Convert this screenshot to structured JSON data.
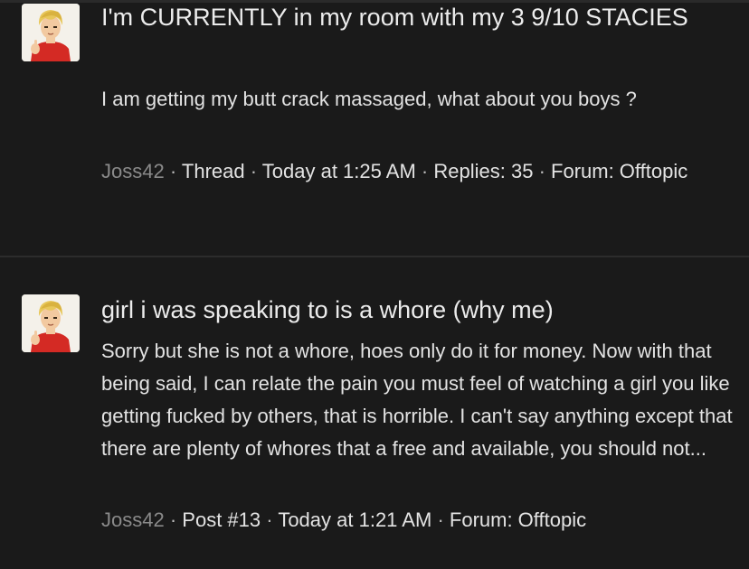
{
  "results": [
    {
      "title": "I'm CURRENTLY in my room with my 3 9/10 STACIES",
      "snippet": "I am getting my butt crack massaged, what about you boys ?",
      "meta": {
        "author": "Joss42",
        "type": "Thread",
        "date": "Today at 1:25 AM",
        "replies": "Replies: 35",
        "forum": "Forum: Offtopic"
      }
    },
    {
      "title": "girl i was speaking to is a whore (why me)",
      "snippet": "Sorry but she is not a whore, hoes only do it for money. Now with that being said, I can relate the pain you must feel of watching a girl you like getting fucked by others, that is horrible. I can't say anything except that there are plenty of whores that a free and available, you should not...",
      "meta": {
        "author": "Joss42",
        "type": "Post #13",
        "date": "Today at 1:21 AM",
        "forum": "Forum: Offtopic"
      }
    }
  ],
  "separator": "·",
  "avatar_icon": "anime-avatar-icon",
  "colors": {
    "background": "#1a1a1a",
    "text": "#e3e3e3",
    "author": "#8a8a8a",
    "divider": "#2c2c2c"
  }
}
